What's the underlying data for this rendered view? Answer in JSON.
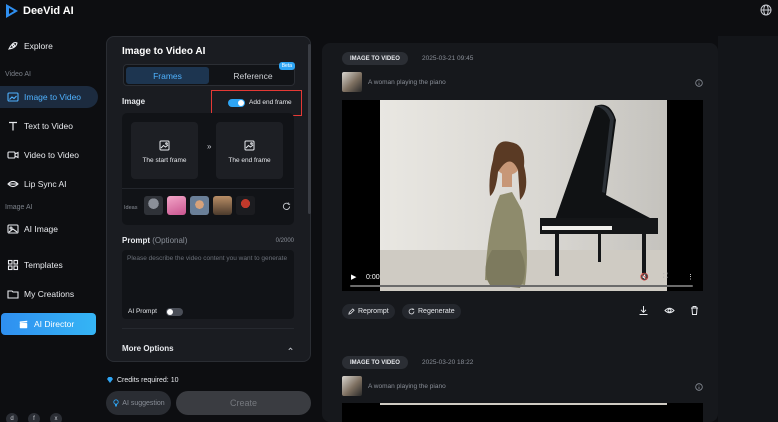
{
  "app": {
    "brand": "DeeVid AI"
  },
  "sidebar": {
    "explore": "Explore",
    "video_ai_section": "Video AI",
    "image_to_video": "Image to Video",
    "text_to_video": "Text to Video",
    "video_to_video": "Video to Video",
    "lip_sync": "Lip Sync AI",
    "image_ai_section": "Image AI",
    "ai_image": "AI Image",
    "templates": "Templates",
    "my_creations": "My Creations",
    "ai_director": "AI Director"
  },
  "panel": {
    "title": "Image to Video AI",
    "tab_frames": "Frames",
    "tab_reference": "Reference",
    "beta_badge": "Beta",
    "image_label": "Image",
    "add_end_frame": "Add end frame",
    "add_end_frame_on": true,
    "start_frame": "The start frame",
    "end_frame": "The end frame",
    "frame_separator": "»",
    "ideas_label": "Ideas",
    "prompt_label": "Prompt",
    "prompt_optional": "(Optional)",
    "char_count": "0/2000",
    "prompt_placeholder": "Please describe the video content you want to generate",
    "ai_prompt_label": "AI Prompt",
    "ai_prompt_on": false,
    "more_options": "More Options"
  },
  "footer": {
    "credits": "Credits required: 10",
    "ai_suggestion": "AI suggestion",
    "create": "Create"
  },
  "results": [
    {
      "badge": "IMAGE TO VIDEO",
      "date": "2025-03-21 09:45",
      "caption": "A woman playing the piano",
      "time": "0:00",
      "reprompt": "Reprompt",
      "regenerate": "Regenerate"
    },
    {
      "badge": "IMAGE TO VIDEO",
      "date": "2025-03-20 18:22",
      "caption": "A woman playing the piano"
    }
  ],
  "colors": {
    "accent": "#2ea5f4",
    "highlight": "#e53935",
    "background": "#0d0e11",
    "panel": "#1a1c21"
  }
}
